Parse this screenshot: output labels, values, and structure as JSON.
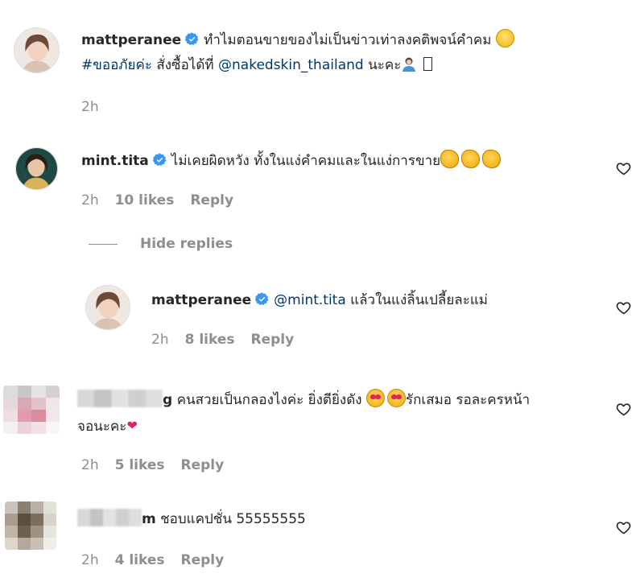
{
  "post": {
    "username": "mattperanee",
    "caption_line1": "ทำไมตอนขายของไม่เป็นข่าวเท่าลงคติพจน์คำคม",
    "hashtag": "#ขออภัยค่ะ",
    "caption_mid": "สั่งซื้อได้ที่",
    "mention": "@nakedskin_thailand",
    "caption_end": "นะคะ",
    "time": "2h"
  },
  "comments": [
    {
      "username": "mint.tita",
      "text": "ไม่เคยผิดหวัง ทั้งในแง่คำคมและในแง่การขาย",
      "time": "2h",
      "likes": "10 likes",
      "reply": "Reply"
    },
    {
      "username": "mattperanee",
      "mention": "@mint.tita",
      "text": "แล้วในแง่ลิ้นเปลี้ยละแม่",
      "time": "2h",
      "likes": "8 likes",
      "reply": "Reply"
    },
    {
      "username_suffix": "g",
      "text_line1_a": "คนสวยเป็นกลองไงค่ะ ยิ่งตียิ่งดัง",
      "text_line1_b": "รักเสมอ รอละครหน้า",
      "text_line2": "จอนะคะ",
      "time": "2h",
      "likes": "5 likes",
      "reply": "Reply"
    },
    {
      "username_suffix": "m",
      "text": "ชอบแคปชั่น 55555555",
      "time": "2h",
      "likes": "4 likes",
      "reply": "Reply"
    }
  ],
  "hide_replies_label": "Hide replies",
  "colors": {
    "verified": "#3897f0",
    "link": "#00376b",
    "muted": "#8e8e8e",
    "text": "#262626"
  }
}
